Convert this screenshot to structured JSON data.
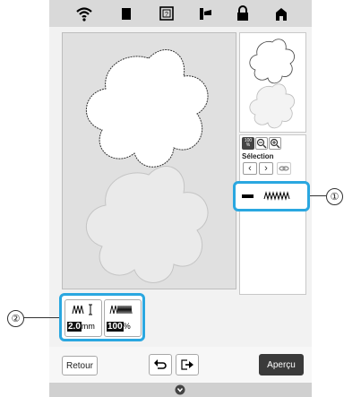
{
  "topbar": {
    "icons": [
      "wifi-icon",
      "document-icon",
      "help-icon",
      "thread-icon",
      "lock-icon",
      "home-icon"
    ]
  },
  "side": {
    "zoom_label": "100\n%",
    "selection_label": "Sélection"
  },
  "stitch": {
    "width_value": "2.0",
    "width_unit": "mm",
    "density_value": "100",
    "density_unit": "%"
  },
  "callouts": {
    "one": "①",
    "two": "②"
  },
  "bottom": {
    "back_label": "Retour",
    "preview_label": "Aperçu"
  },
  "colors": {
    "highlight": "#2aa7e0",
    "preview_button": "#3a3a3a"
  }
}
